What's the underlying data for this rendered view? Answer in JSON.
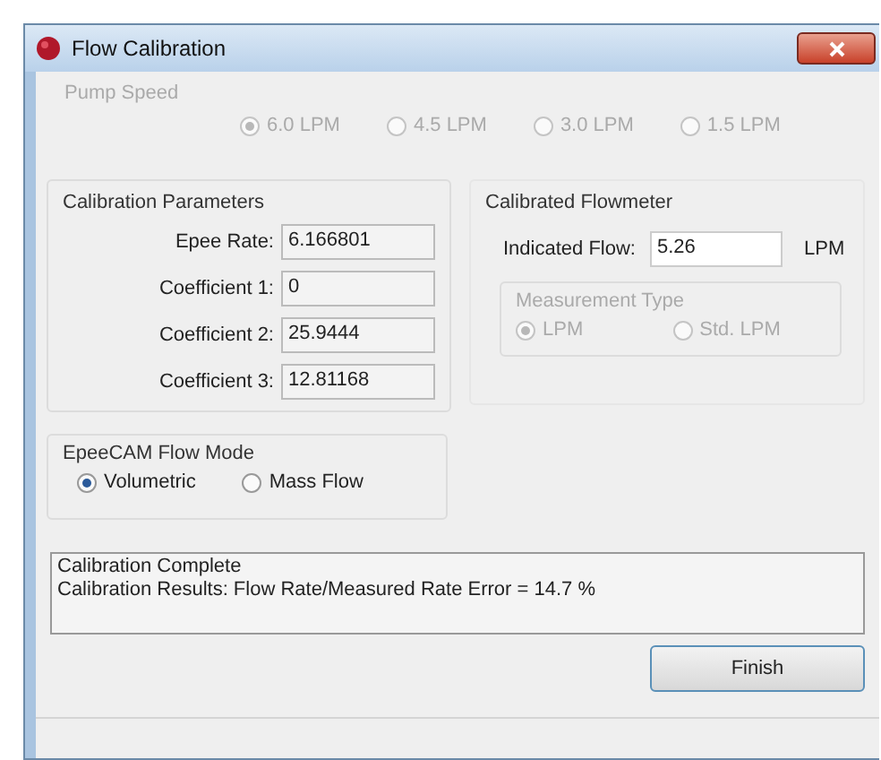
{
  "window": {
    "title": "Flow Calibration"
  },
  "pump_speed": {
    "title": "Pump Speed",
    "disabled": true,
    "options": [
      {
        "label": "6.0 LPM",
        "selected": true
      },
      {
        "label": "4.5 LPM",
        "selected": false
      },
      {
        "label": "3.0 LPM",
        "selected": false
      },
      {
        "label": "1.5 LPM",
        "selected": false
      }
    ]
  },
  "calibration_parameters": {
    "title": "Calibration Parameters",
    "fields": [
      {
        "label": "Epee Rate:",
        "value": "6.166801"
      },
      {
        "label": "Coefficient 1:",
        "value": "0"
      },
      {
        "label": "Coefficient 2:",
        "value": "25.9444"
      },
      {
        "label": "Coefficient 3:",
        "value": "12.81168"
      }
    ]
  },
  "calibrated_flowmeter": {
    "title": "Calibrated Flowmeter",
    "indicated_flow": {
      "label": "Indicated Flow:",
      "value": "5.26",
      "unit": "LPM"
    },
    "measurement_type": {
      "title": "Measurement Type",
      "disabled": true,
      "options": [
        {
          "label": "LPM",
          "selected": true
        },
        {
          "label": "Std. LPM",
          "selected": false
        }
      ]
    }
  },
  "flow_mode": {
    "title": "EpeeCAM Flow Mode",
    "disabled": false,
    "options": [
      {
        "label": "Volumetric",
        "selected": true
      },
      {
        "label": "Mass Flow",
        "selected": false
      }
    ]
  },
  "results": [
    "Calibration Complete",
    "Calibration Results: Flow Rate/Measured Rate Error = 14.7 %"
  ],
  "buttons": [
    "Finish"
  ]
}
